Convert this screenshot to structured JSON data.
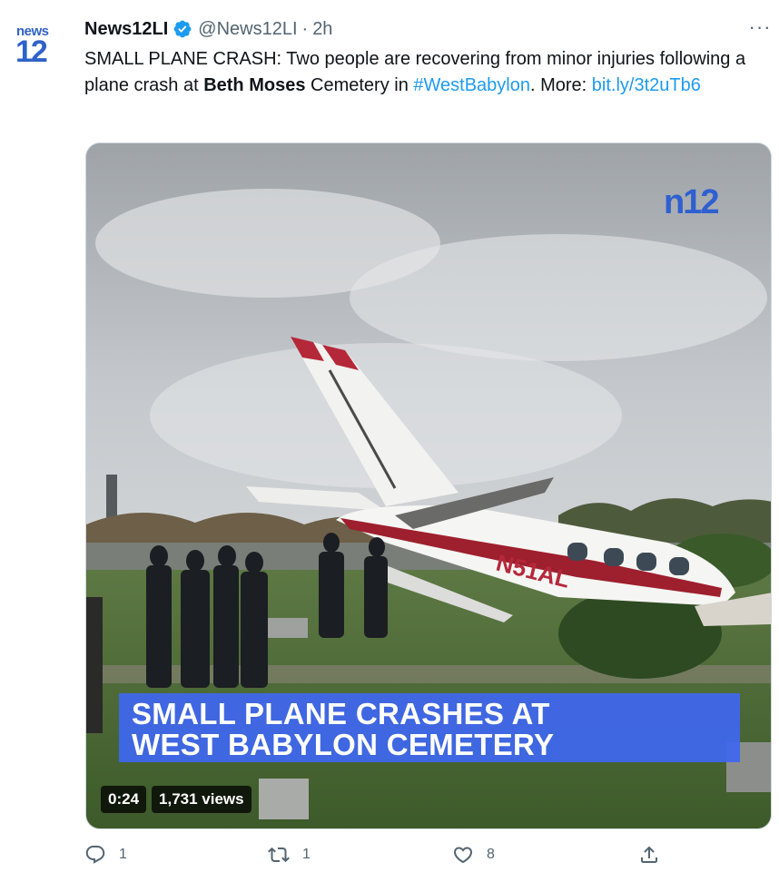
{
  "author": {
    "avatar_text_top": "news",
    "avatar_text_bottom": "12",
    "display_name": "News12LI",
    "handle": "@News12LI",
    "separator": "·",
    "time": "2h",
    "verified_icon": "verified-badge-icon"
  },
  "tweet": {
    "text_part1": "SMALL PLANE CRASH: Two people are recovering from minor injuries following a plane crash at ",
    "bold_text": "Beth Moses",
    "text_part2": " Cemetery in ",
    "hashtag": "#WestBabylon",
    "text_part3": ". More:",
    "link": "bit.ly/3t2uTb6"
  },
  "more_icon": "more-horizontal-icon",
  "more_label": "···",
  "media": {
    "logo": "n12",
    "plane_registration": "N51AL",
    "banner_line1": "SMALL PLANE CRASHES AT",
    "banner_line2": "WEST BABYLON CEMETERY",
    "duration": "0:24",
    "views": "1,731 views"
  },
  "actions": {
    "reply_count": "1",
    "retweet_count": "1",
    "like_count": "8",
    "reply_icon": "reply-icon",
    "retweet_icon": "retweet-icon",
    "like_icon": "heart-icon",
    "share_icon": "share-icon"
  },
  "colors": {
    "link_blue": "#1d9bf0",
    "secondary_text": "#536471",
    "brand_blue": "#2f62c8",
    "banner_blue": "#3f67f0"
  }
}
